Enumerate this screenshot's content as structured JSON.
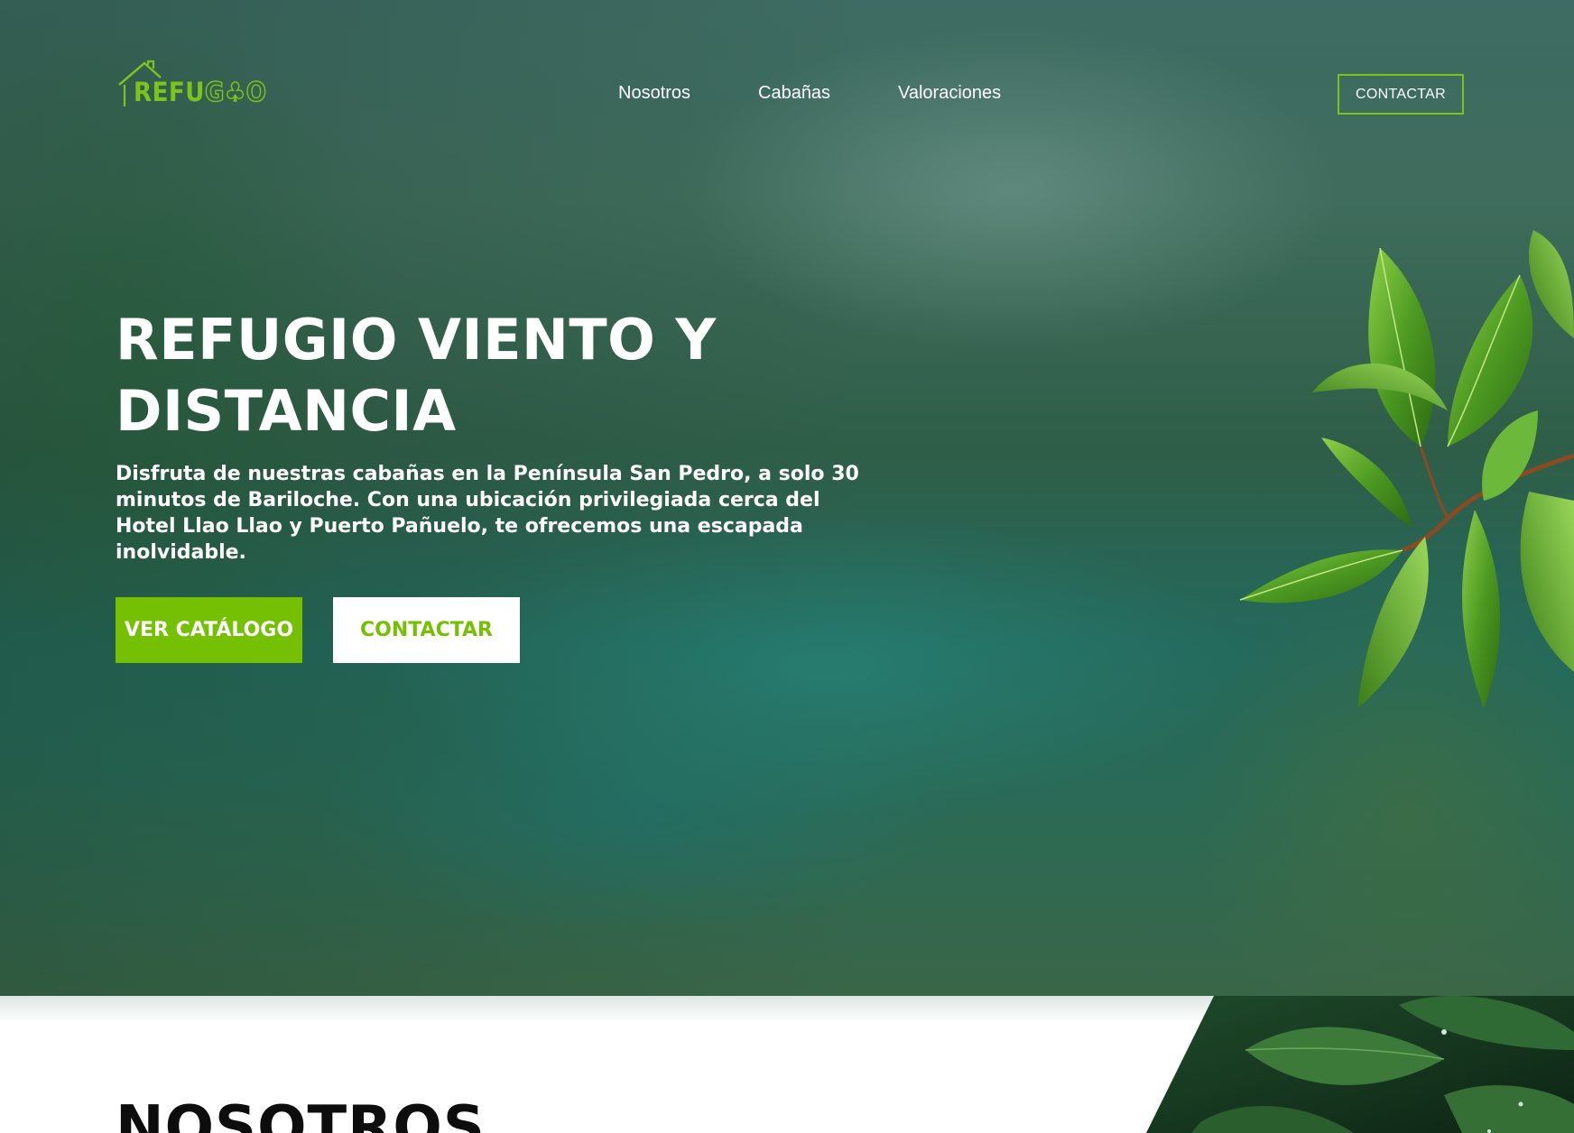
{
  "brand": {
    "logo_icon": "house-tree-logo-icon",
    "logo_text_fill": "REFU",
    "logo_text_outline": "G",
    "logo_text_outline_end": "O",
    "accent_color": "#76c004"
  },
  "nav": {
    "items": [
      {
        "label": "Nosotros"
      },
      {
        "label": "Cabañas"
      },
      {
        "label": "Valoraciones"
      }
    ],
    "contact_label": "CONTACTAR"
  },
  "hero": {
    "title_line1": "REFUGIO VIENTO Y",
    "title_line2": "DISTANCIA",
    "description": "Disfruta de nuestras cabañas en la Península San Pedro, a solo 30 minutos de Bariloche. Con una ubicación privilegiada cerca del Hotel Llao Llao y Puerto Pañuelo, te ofrecemos una escapada inolvidable.",
    "primary_button": "VER CATÁLOGO",
    "secondary_button": "CONTACTAR"
  },
  "about": {
    "title": "NOSOTROS"
  }
}
